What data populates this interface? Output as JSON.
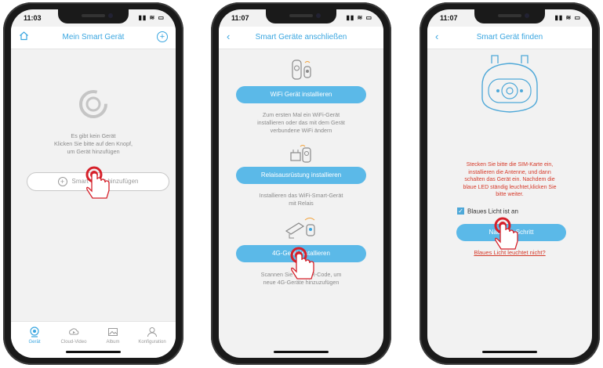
{
  "phone1": {
    "time": "11:03",
    "title": "Mein Smart Gerät",
    "empty_lines": [
      "Es gibt kein Gerät",
      "Klicken Sie bitte auf den Knopf,",
      "um Gerät hinzufügen"
    ],
    "add_button_label": "Smart Gerät hinzufügen",
    "tabs": [
      {
        "label": "Gerät",
        "icon": "device-icon",
        "active": true
      },
      {
        "label": "Cloud-Video",
        "icon": "cloud-video-icon",
        "active": false
      },
      {
        "label": "Album",
        "icon": "album-icon",
        "active": false
      },
      {
        "label": "Konfiguration",
        "icon": "user-icon",
        "active": false
      }
    ]
  },
  "phone2": {
    "time": "11:07",
    "title": "Smart Geräte anschließen",
    "options": [
      {
        "button": "WiFi Gerät installieren",
        "desc": [
          "Zum ersten Mal ein WiFi-Gerät",
          "installieren oder das mit dem Gerät",
          "verbundene WiFi ändern"
        ]
      },
      {
        "button": "Relaisausrüstung installieren",
        "desc": [
          "Installieren das WiFi-Smart-Gerät",
          "mit Relais"
        ]
      },
      {
        "button": "4G-Gerät installieren",
        "desc": [
          "Scannen Sie bitte QR-Code, um",
          "neue 4G-Geräte hinzuzufügen"
        ]
      }
    ]
  },
  "phone3": {
    "time": "11:07",
    "title": "Smart Gerät finden",
    "instructions": [
      "Stecken Sie bitte die SIM-Karte ein,",
      "installieren die Antenne, und dann",
      "schalten das Gerät ein. Nachdem die",
      "blaue LED ständig leuchtet,klicken Sie",
      "bitte weiter."
    ],
    "checkbox_label": "Blaues Licht ist an",
    "checkbox_checked": true,
    "next_button": "Nächster Schritt",
    "help_link": "Blaues Licht leuchtet nicht?"
  },
  "colors": {
    "accent": "#3aa6e0",
    "button": "#5bb9e8",
    "warning": "#d63a2a",
    "pointer": "#d6202a"
  }
}
